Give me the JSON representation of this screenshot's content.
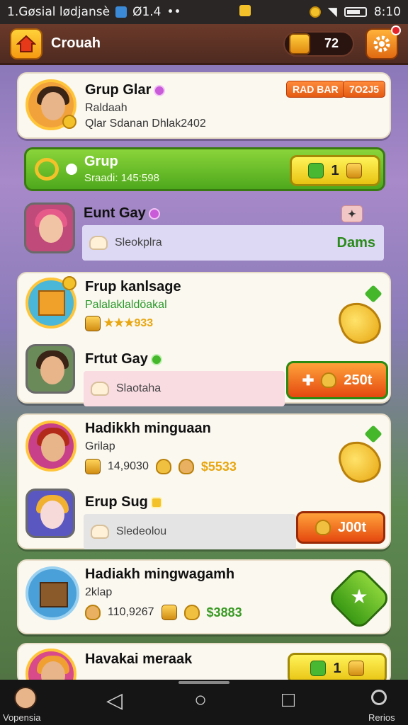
{
  "status_bar": {
    "left_text": "1.Gøsial lødjansè",
    "mid_text": "Ø1.4",
    "ellipsis": "••",
    "time": "8:10"
  },
  "header": {
    "title": "Crouah",
    "currency_value": "72"
  },
  "cards": {
    "c1": {
      "title": "Grup Glar",
      "sub1": "Raldaah",
      "sub2": "Qlar Sdanan Dhlak2402",
      "tag1": "RAD BAR",
      "tag2": "7O2J5"
    },
    "green": {
      "title": "Grup",
      "sub": "Sraadi: 145:598",
      "value": "1"
    },
    "c2": {
      "title": "Eunt Gay",
      "bar_text": "Sleokplra",
      "bar_right": "Dams"
    },
    "c3": {
      "title": "Frup kanlsage",
      "sub": "Palalaklaldöakal",
      "stars": "★★★933"
    },
    "c4": {
      "title": "Frtut Gay",
      "bar_text": "Slaotaha",
      "btn_value": "250t"
    },
    "c5": {
      "title": "Hadikkh minguaan",
      "sub": "Grilap",
      "value1": "14,9030",
      "money": "$5533"
    },
    "c6": {
      "title": "Erup Sug",
      "bar_text": "Sledeolou",
      "btn_value": "J00t"
    },
    "c7": {
      "title": "Hadiakh mingwagamh",
      "sub": "2klap",
      "value1": "110,9267",
      "money": "$3883"
    },
    "c8": {
      "title": "Havakai meraak",
      "btn_value": "1"
    }
  },
  "navbar": {
    "left_label": "Vopensia",
    "right_label": "Rerios"
  },
  "colors": {
    "accent": "#ff8b3a",
    "green": "#4ea81c",
    "header": "#5a2f22"
  }
}
